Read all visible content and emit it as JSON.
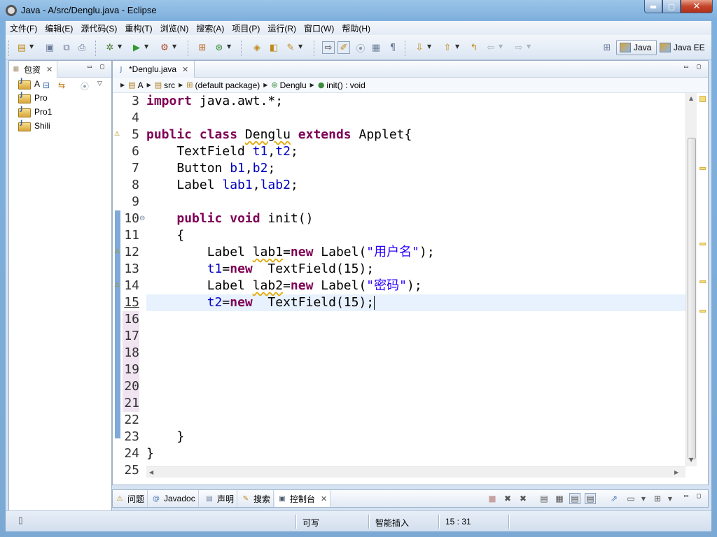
{
  "window": {
    "title": "Java  -  A/src/Denglu.java  -  Eclipse",
    "controls": {
      "minimize": "▬",
      "maximize": "▢",
      "close": "✕"
    }
  },
  "menu": [
    "文件(F)",
    "编辑(E)",
    "源代码(S)",
    "重构(T)",
    "浏览(N)",
    "搜索(A)",
    "项目(P)",
    "运行(R)",
    "窗口(W)",
    "帮助(H)"
  ],
  "perspectives": {
    "java": "Java",
    "javaee": "Java EE"
  },
  "package_explorer": {
    "tab_label": "包资",
    "projects": [
      "A",
      "Pro",
      "Pro1",
      "Shili"
    ]
  },
  "editor": {
    "tab_label": "*Denglu.java",
    "breadcrumb": [
      "A",
      "src",
      "(default package)",
      "Denglu",
      "init() : void"
    ],
    "line_numbers": [
      "3",
      "4",
      "5",
      "6",
      "7",
      "8",
      "9",
      "10",
      "11",
      "12",
      "13",
      "14",
      "15",
      "16",
      "17",
      "18",
      "19",
      "20",
      "21",
      "22",
      "23",
      "24",
      "25"
    ],
    "code": {
      "l3_kw": "import",
      "l3_rest": " java.awt.*;",
      "l5_kw1": "public",
      "l5_kw2": "class",
      "l5_name": "Denglu",
      "l5_kw3": "extends",
      "l5_rest": " Applet{",
      "l6_type": "    TextField ",
      "l6_f1": "t1",
      "l6_sep": ",",
      "l6_f2": "t2",
      "l6_end": ";",
      "l7_type": "    Button ",
      "l7_f1": "b1",
      "l7_sep": ",",
      "l7_f2": "b2",
      "l7_end": ";",
      "l8_type": "    Label ",
      "l8_f1": "lab1",
      "l8_sep": ",",
      "l8_f2": "lab2",
      "l8_end": ";",
      "l10_kw1": "public",
      "l10_kw2": "void",
      "l10_rest": " init()",
      "l11": "    {",
      "l12_a": "        Label ",
      "l12_var": "lab1",
      "l12_eq": "=",
      "l12_kw": "new",
      "l12_b": " Label(",
      "l12_str": "\"用户名\"",
      "l12_c": ");",
      "l13_f": "t1",
      "l13_eq": "=",
      "l13_kw": "new",
      "l13_rest": "  TextField(15);",
      "l14_a": "        Label ",
      "l14_var": "lab2",
      "l14_eq": "=",
      "l14_kw": "new",
      "l14_b": " Label(",
      "l14_str": "\"密码\"",
      "l14_c": ");",
      "l15_f": "t2",
      "l15_eq": "=",
      "l15_kw": "new",
      "l15_rest": "  TextField(15);",
      "l23": "    }",
      "l24": "}"
    }
  },
  "bottom_tabs": [
    "问题",
    "Javadoc",
    "声明",
    "搜索",
    "控制台"
  ],
  "status": {
    "writable": "可写",
    "insert_mode": "智能插入",
    "position": "15 : 31"
  },
  "colors": {
    "keyword": "#7f0055",
    "field": "#0000c0",
    "string": "#2a00ff",
    "current_line": "#e8f2fe"
  }
}
